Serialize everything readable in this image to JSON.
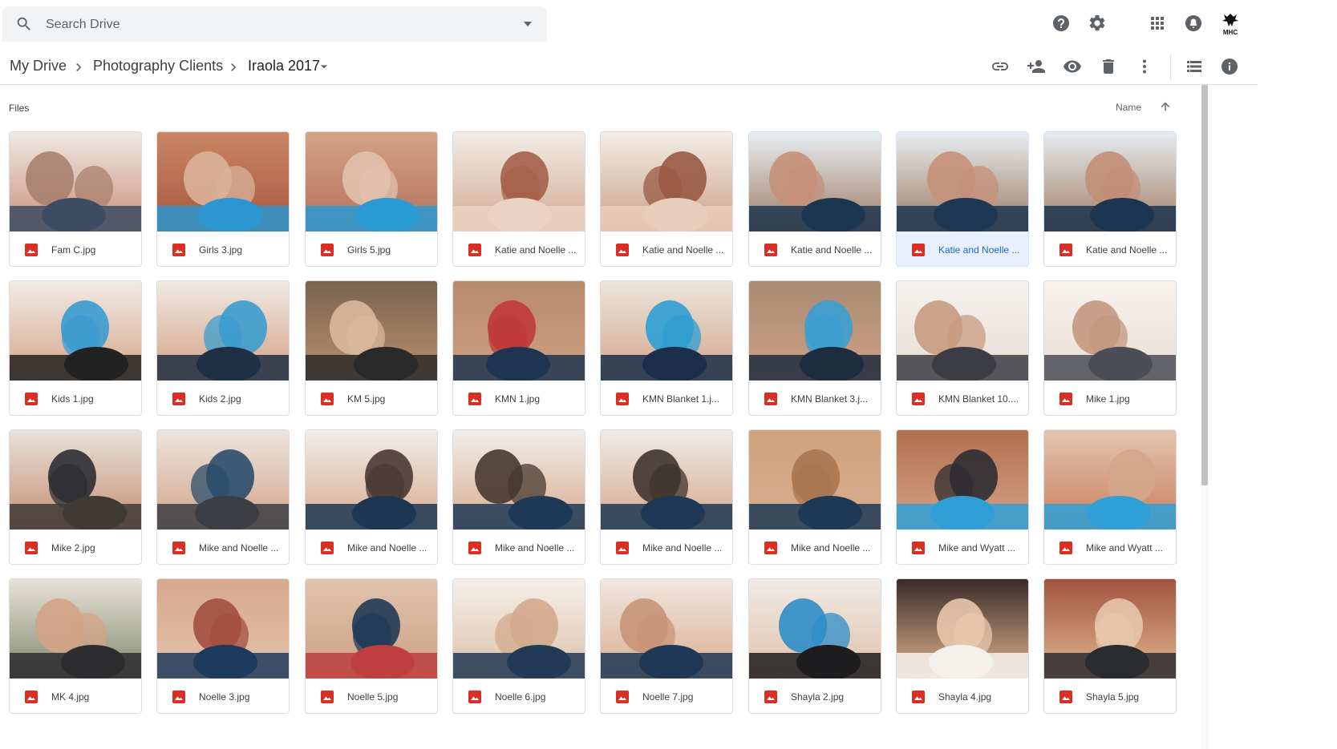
{
  "search": {
    "placeholder": "Search Drive"
  },
  "header_icons": [
    "help-icon",
    "settings-icon",
    "apps-icon",
    "notifications-icon",
    "account-avatar"
  ],
  "account": {
    "logo_text": "MHC"
  },
  "breadcrumb": [
    "My Drive",
    "Photography Clients",
    "Iraola 2017"
  ],
  "toolbar_icons": [
    "get-link-icon",
    "share-icon",
    "preview-icon",
    "remove-icon",
    "more-actions-icon",
    "list-view-icon",
    "details-icon"
  ],
  "files": {
    "section_label": "Files",
    "sort_label": "Name",
    "sort_direction": "ascending",
    "items": [
      {
        "name": "Fam C.jpg",
        "selected": false,
        "colors": [
          "#efe9e4",
          "#c98f78",
          "#a9806f",
          "#3d4c63"
        ]
      },
      {
        "name": "Girls 3.jpg",
        "selected": false,
        "colors": [
          "#c98663",
          "#a8573e",
          "#d9b299",
          "#2b96cf"
        ]
      },
      {
        "name": "Girls 5.jpg",
        "selected": false,
        "colors": [
          "#d4a287",
          "#b4705a",
          "#e0c1ad",
          "#2a9bd3"
        ]
      },
      {
        "name": "Katie and Noelle ...",
        "selected": false,
        "colors": [
          "#f3ece6",
          "#d3aa92",
          "#a4614a",
          "#ecd2c2"
        ]
      },
      {
        "name": "Katie and Noelle ...",
        "selected": false,
        "colors": [
          "#f4ede7",
          "#caa187",
          "#985a43",
          "#e9cdbb"
        ]
      },
      {
        "name": "Katie and Noelle ...",
        "selected": false,
        "colors": [
          "#e6eef3",
          "#9f7b62",
          "#c58f78",
          "#1d3650"
        ]
      },
      {
        "name": "Katie and Noelle ...",
        "selected": true,
        "colors": [
          "#e6edf2",
          "#9e7a60",
          "#c69079",
          "#1e3752"
        ]
      },
      {
        "name": "Katie and Noelle ...",
        "selected": false,
        "colors": [
          "#e5ecf1",
          "#a27d63",
          "#c38e77",
          "#1c3550"
        ]
      },
      {
        "name": "Kids 1.jpg",
        "selected": false,
        "colors": [
          "#f1ebe6",
          "#d6a488",
          "#3a9bd0",
          "#222222"
        ]
      },
      {
        "name": "Kids 2.jpg",
        "selected": false,
        "colors": [
          "#f0e9e3",
          "#d4a184",
          "#3b9ccf",
          "#1f2f44"
        ]
      },
      {
        "name": "KM 5.jpg",
        "selected": false,
        "colors": [
          "#7a6450",
          "#b98f70",
          "#d9b89c",
          "#2a2a2a"
        ]
      },
      {
        "name": "KMN 1.jpg",
        "selected": false,
        "colors": [
          "#b78a6b",
          "#cf9f80",
          "#c0393b",
          "#1d3550"
        ]
      },
      {
        "name": "KMN Blanket 1.j...",
        "selected": false,
        "colors": [
          "#ece4dc",
          "#d3a78b",
          "#2e9dd3",
          "#1b2f4a"
        ]
      },
      {
        "name": "KMN Blanket 3.j...",
        "selected": false,
        "colors": [
          "#a88a72",
          "#cfa086",
          "#3a9fd1",
          "#1e2c40"
        ]
      },
      {
        "name": "KMN Blanket 10....",
        "selected": false,
        "colors": [
          "#f5f2ef",
          "#e7ddd4",
          "#c89b80",
          "#3c3d44"
        ]
      },
      {
        "name": "Mike 1.jpg",
        "selected": false,
        "colors": [
          "#f7f3ef",
          "#e9ddd2",
          "#c39780",
          "#4b4e57"
        ]
      },
      {
        "name": "Mike 2.jpg",
        "selected": false,
        "colors": [
          "#e9e2db",
          "#c48f72",
          "#2c2e33",
          "#403a36"
        ]
      },
      {
        "name": "Mike and Noelle ...",
        "selected": false,
        "colors": [
          "#ece5de",
          "#d1a287",
          "#2b4d6b",
          "#3c3e44"
        ]
      },
      {
        "name": "Mike and Noelle ...",
        "selected": false,
        "colors": [
          "#f1ede9",
          "#d6a98d",
          "#4a3a33",
          "#1d3753"
        ]
      },
      {
        "name": "Mike and Noelle ...",
        "selected": false,
        "colors": [
          "#f2eeea",
          "#d7ab8f",
          "#47382f",
          "#1f3a57"
        ]
      },
      {
        "name": "Mike and Noelle ...",
        "selected": false,
        "colors": [
          "#f0ebe6",
          "#d4a78b",
          "#3f342d",
          "#1e3855"
        ]
      },
      {
        "name": "Mike and Noelle ...",
        "selected": false,
        "colors": [
          "#cfa27c",
          "#d8ad91",
          "#a9774f",
          "#1d3955"
        ]
      },
      {
        "name": "Mike and Wyatt ...",
        "selected": false,
        "colors": [
          "#b2704e",
          "#d4a487",
          "#2d2e33",
          "#2e9ed5"
        ]
      },
      {
        "name": "Mike and Wyatt ...",
        "selected": false,
        "colors": [
          "#e3c4b0",
          "#c97f5e",
          "#d4a68a",
          "#2fa0d6"
        ]
      },
      {
        "name": "MK 4.jpg",
        "selected": false,
        "colors": [
          "#e8e2d9",
          "#7f8a6a",
          "#d4a386",
          "#2d2d30"
        ]
      },
      {
        "name": "Noelle 3.jpg",
        "selected": false,
        "colors": [
          "#d6a98d",
          "#e4c1ab",
          "#a34f3f",
          "#1e3a5c"
        ]
      },
      {
        "name": "Noelle 5.jpg",
        "selected": false,
        "colors": [
          "#e1c3ae",
          "#caa082",
          "#1f3a56",
          "#bd3f3f"
        ]
      },
      {
        "name": "Noelle 6.jpg",
        "selected": false,
        "colors": [
          "#f5efe8",
          "#dcc1aa",
          "#d3a98c",
          "#223a55"
        ]
      },
      {
        "name": "Noelle 7.jpg",
        "selected": false,
        "colors": [
          "#f0e7df",
          "#d9ad90",
          "#c99377",
          "#1e3856"
        ]
      },
      {
        "name": "Shayla 2.jpg",
        "selected": false,
        "colors": [
          "#f1ebe5",
          "#e0c0a8",
          "#2d8dc8",
          "#1d1d1f"
        ]
      },
      {
        "name": "Shayla 4.jpg",
        "selected": false,
        "colors": [
          "#3b2a28",
          "#e0b690",
          "#e7c7ad",
          "#f4f0ec"
        ]
      },
      {
        "name": "Shayla 5.jpg",
        "selected": false,
        "colors": [
          "#a1543f",
          "#e1b78f",
          "#e6c6ab",
          "#2b2c30"
        ]
      }
    ]
  },
  "colors": {
    "image_file_icon": "#d93025",
    "icon_gray": "#5f6368",
    "selected_background": "#e8f0fe",
    "selected_text": "#1967d2"
  }
}
